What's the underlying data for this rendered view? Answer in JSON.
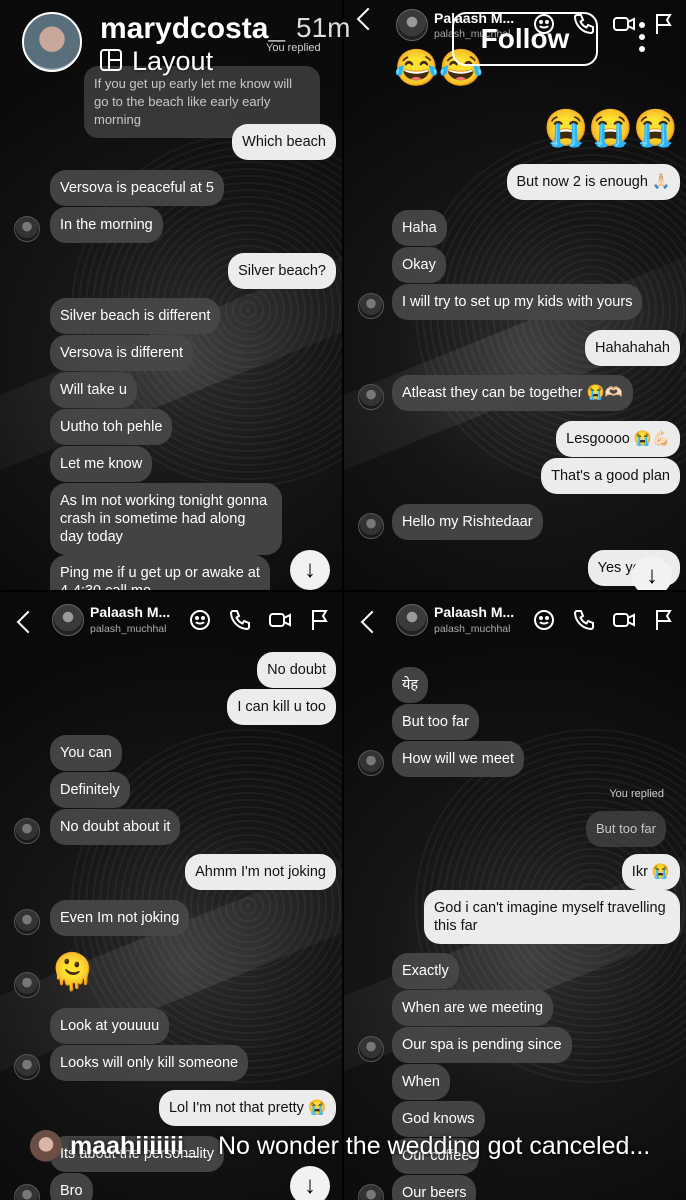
{
  "story": {
    "username": "marydcosta_",
    "time": "51m",
    "layout_label": "Layout",
    "follow_label": "Follow"
  },
  "chat_header": {
    "name": "Palaash M...",
    "username": "palash_muchhal"
  },
  "panel1": {
    "replied_label": "You replied",
    "replied_quote": "If you get up early let me know will go to the beach like early early morning",
    "messages": [
      "Which beach",
      "Versova is peaceful at 5",
      "In the morning",
      "Silver beach?",
      "Silver beach is different",
      "Versova is different",
      "Will take u",
      "Uutho toh pehle",
      "Let me know",
      "As Im not working tonight gonna crash in sometime had along day today",
      "Ping me if u get up or awake at 4-4:30 call me"
    ]
  },
  "panel2": {
    "emojis_top": "😂😂",
    "emojis_right": "😭😭😭",
    "messages": [
      "But now 2 is enough 🙏🏻",
      "Haha",
      "Okay",
      "I will try to set up my kids with yours",
      "Hahahahah",
      "Atleast they can be together 😭🫶🏻",
      "Lesgoooo 😭💪🏻",
      "That's a good plan",
      "Hello my Rishtedaar",
      "Yes yes 😭"
    ]
  },
  "panel3": {
    "emoji": "🫠",
    "messages": [
      "No doubt",
      "I can kill u too",
      "You can",
      "Definitely",
      "No doubt about it",
      "Ahmm I'm not joking",
      "Even Im not joking",
      "Look at youuuu",
      "Looks will only kill someone",
      "Lol I'm not that pretty 😭",
      "Its about the personality",
      "Bro"
    ]
  },
  "panel4": {
    "replied_label": "You replied",
    "replied_quote": "But too far",
    "messages": [
      "येह",
      "But too far",
      "How will we meet",
      "Ikr 😭",
      "God i can't imagine myself travelling this far",
      "Exactly",
      "When are we meeting",
      "Our spa is pending since",
      "When",
      "God knows",
      "Our coffee",
      "Our beers"
    ]
  },
  "comment": {
    "username": "maahiiiiiii_",
    "text": "No wonder the wedding got canceled..."
  },
  "icons": {
    "scroll_down": "↓",
    "header_icons": [
      "back-icon",
      "sticker-icon",
      "phone-icon",
      "video-icon",
      "flag-icon"
    ]
  }
}
